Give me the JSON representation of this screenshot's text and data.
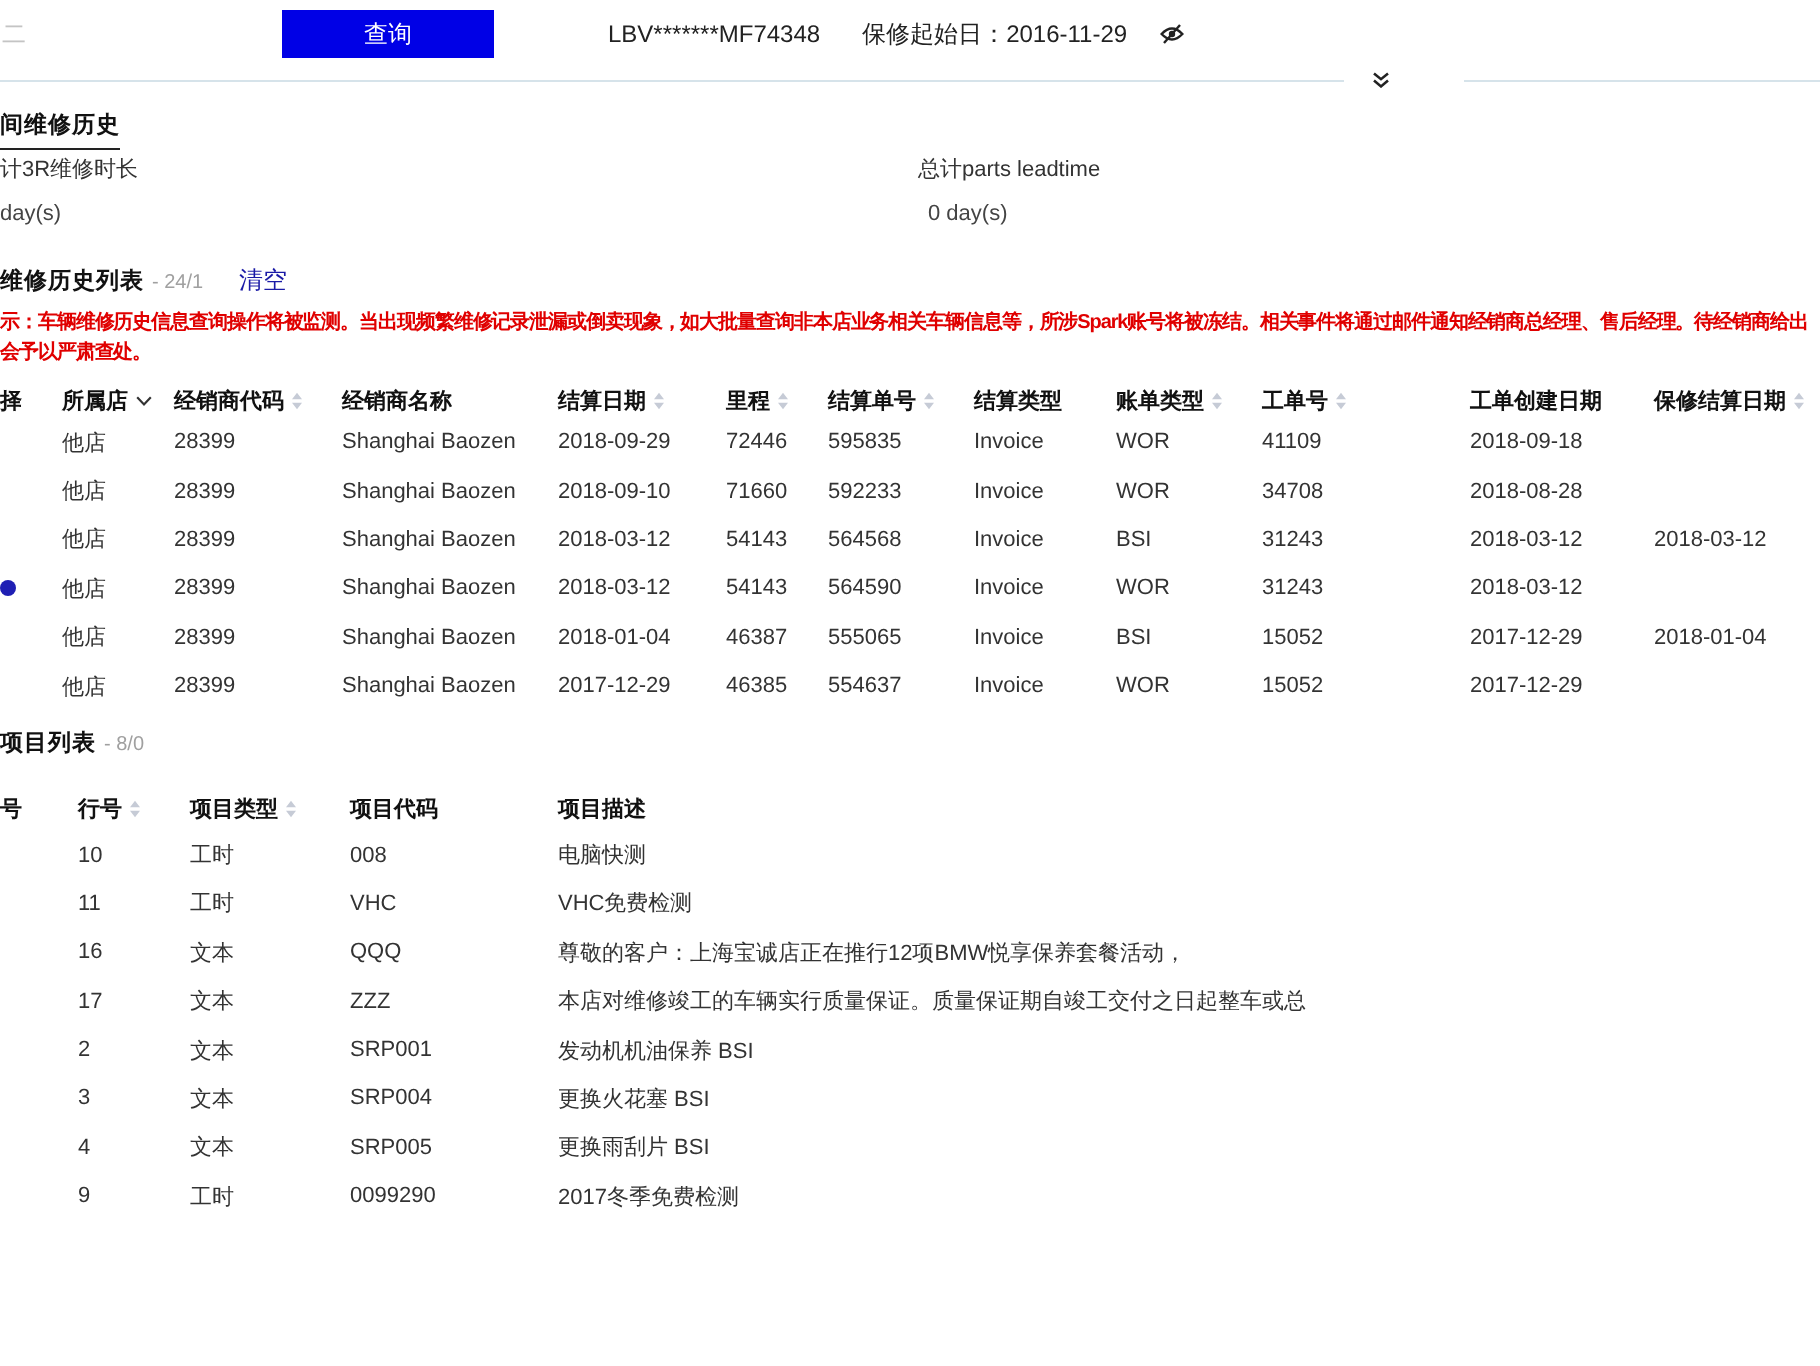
{
  "search_bar": {
    "vin_field": {
      "placeholder": "二"
    },
    "query_button": "查询",
    "vin": "LBV*******MF74348",
    "warranty_start": "保修起始日：2016-11-29"
  },
  "summary": {
    "tab": {
      "label": "间维修历史",
      "selected": true
    },
    "metrics": [
      {
        "label": "计3R维修时长",
        "value": "day(s)"
      },
      {
        "label": "总计parts leadtime",
        "value": "0 day(s)"
      }
    ]
  },
  "history": {
    "title": "维修历史列表",
    "count": "- 24/1",
    "clear_link": "清空",
    "notice": [
      "示：车辆维修历史信息查询操作将被监测。当出现频繁维修记录泄漏或倒卖现象，如大批量查询非本店业务相关车辆信息等，所涉Spark账号将被冻结。相关事件将通过邮件通知经销商总经理、售后经理。待经销商给出",
      "会予以严肃查处。"
    ],
    "table": {
      "columns": [
        {
          "label": "择",
          "sortable": false,
          "filter": false
        },
        {
          "label": "所属店",
          "sortable": false,
          "filter": true
        },
        {
          "label": "经销商代码",
          "sortable": true,
          "filter": false
        },
        {
          "label": "经销商名称",
          "sortable": false,
          "filter": false
        },
        {
          "label": "结算日期",
          "sortable": true,
          "filter": false
        },
        {
          "label": "里程",
          "sortable": true,
          "filter": false
        },
        {
          "label": "结算单号",
          "sortable": true,
          "filter": false
        },
        {
          "label": "结算类型",
          "sortable": false,
          "filter": false
        },
        {
          "label": "账单类型",
          "sortable": true,
          "filter": false
        },
        {
          "label": "工单号",
          "sortable": true,
          "filter": false
        },
        {
          "label": "工单创建日期",
          "sortable": false,
          "filter": false
        },
        {
          "label": "保修结算日期",
          "sortable": true,
          "filter": false
        }
      ],
      "rows": [
        {
          "selected": false,
          "cells": [
            "",
            "他店",
            "28399",
            "Shanghai Baozen",
            "2018-09-29",
            "72446",
            "595835",
            "Invoice",
            "WOR",
            "41109",
            "2018-09-18",
            ""
          ]
        },
        {
          "selected": false,
          "cells": [
            "",
            "他店",
            "28399",
            "Shanghai Baozen",
            "2018-09-10",
            "71660",
            "592233",
            "Invoice",
            "WOR",
            "34708",
            "2018-08-28",
            ""
          ]
        },
        {
          "selected": false,
          "cells": [
            "",
            "他店",
            "28399",
            "Shanghai Baozen",
            "2018-03-12",
            "54143",
            "564568",
            "Invoice",
            "BSI",
            "31243",
            "2018-03-12",
            "2018-03-12"
          ]
        },
        {
          "selected": true,
          "cells": [
            "",
            "他店",
            "28399",
            "Shanghai Baozen",
            "2018-03-12",
            "54143",
            "564590",
            "Invoice",
            "WOR",
            "31243",
            "2018-03-12",
            ""
          ]
        },
        {
          "selected": false,
          "cells": [
            "",
            "他店",
            "28399",
            "Shanghai Baozen",
            "2018-01-04",
            "46387",
            "555065",
            "Invoice",
            "BSI",
            "15052",
            "2017-12-29",
            "2018-01-04"
          ]
        },
        {
          "selected": false,
          "cells": [
            "",
            "他店",
            "28399",
            "Shanghai Baozen",
            "2017-12-29",
            "46385",
            "554637",
            "Invoice",
            "WOR",
            "15052",
            "2017-12-29",
            ""
          ]
        }
      ]
    }
  },
  "items": {
    "title": "项目列表",
    "count": "- 8/0",
    "table": {
      "columns": [
        {
          "label": "号",
          "sortable": false
        },
        {
          "label": "行号",
          "sortable": true
        },
        {
          "label": "项目类型",
          "sortable": true
        },
        {
          "label": "项目代码",
          "sortable": false
        },
        {
          "label": "项目描述",
          "sortable": false
        }
      ],
      "rows": [
        {
          "cells": [
            "",
            "10",
            "工时",
            "008",
            "电脑快测"
          ]
        },
        {
          "cells": [
            "",
            "11",
            "工时",
            "VHC",
            "VHC免费检测"
          ]
        },
        {
          "cells": [
            "",
            "16",
            "文本",
            "QQQ",
            "尊敬的客户：上海宝诚店正在推行12项BMW悦享保养套餐活动，"
          ]
        },
        {
          "cells": [
            "",
            "17",
            "文本",
            "ZZZ",
            "本店对维修竣工的车辆实行质量保证。质量保证期自竣工交付之日起整车或总"
          ]
        },
        {
          "cells": [
            "",
            "2",
            "文本",
            "SRP001",
            "发动机机油保养 BSI"
          ]
        },
        {
          "cells": [
            "",
            "3",
            "文本",
            "SRP004",
            "更换火花塞 BSI"
          ]
        },
        {
          "cells": [
            "",
            "4",
            "文本",
            "SRP005",
            "更换雨刮片 BSI"
          ]
        },
        {
          "cells": [
            "",
            "9",
            "工时",
            "0099290",
            "2017冬季免费检测"
          ]
        }
      ]
    }
  }
}
